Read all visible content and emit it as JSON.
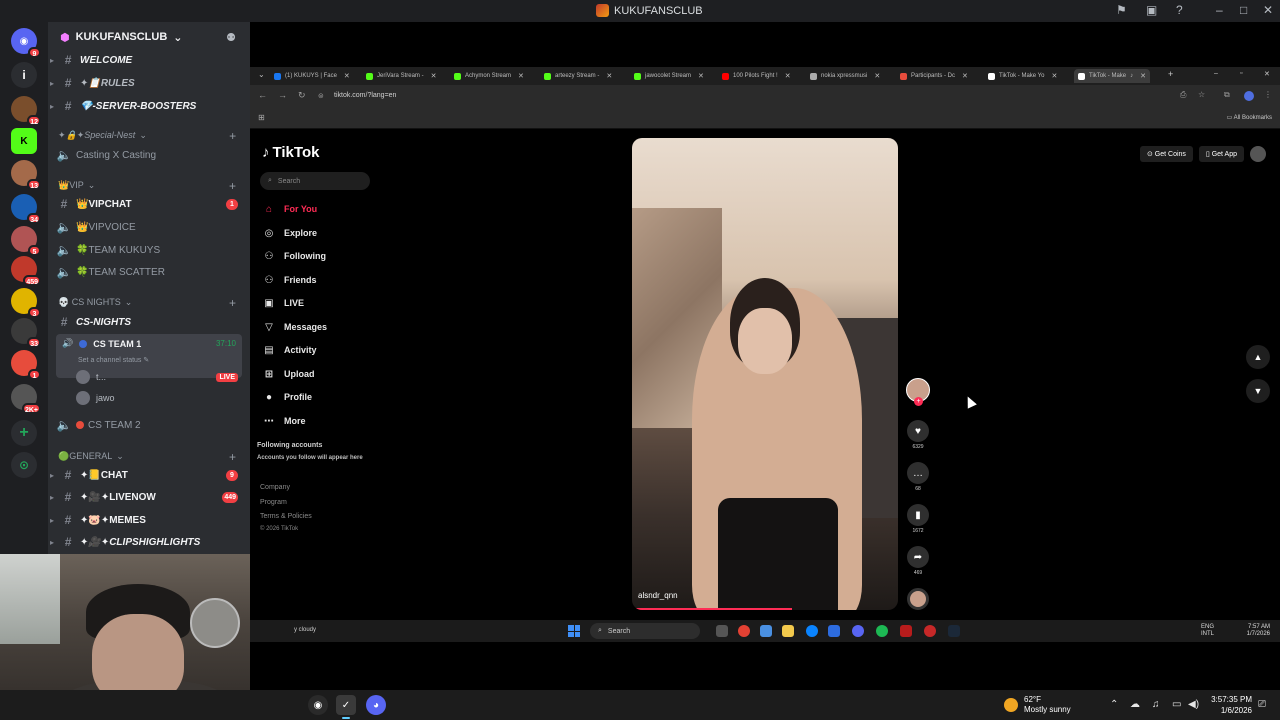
{
  "discord": {
    "title": "KUKUFANSCLUB",
    "server_name": "KUKUFANSCLUB",
    "server_badges": [
      "9",
      "12",
      "13",
      "34",
      "5",
      "459",
      "3",
      "33",
      "1",
      "2K+"
    ],
    "channels": [
      {
        "label": "WELCOME",
        "style": "ital"
      },
      {
        "label": "✦📋RULES",
        "style": "ital"
      },
      {
        "label": "💎-SERVER-BOOSTERS",
        "style": "ital"
      }
    ],
    "cat_special": "✦🔒✦Special-Nest",
    "voice_casting": "Casting X Casting",
    "cat_vip": "👑VIP",
    "vip_channels": [
      {
        "label": "👑VIPCHAT",
        "count": "1"
      },
      {
        "label": "👑VIPVOICE"
      },
      {
        "label": "🍀TEAM KUKUYS"
      },
      {
        "label": "🍀TEAM SCATTER"
      }
    ],
    "cat_cs": "💀 CS NIGHTS",
    "cs_nights": "CS-NIGHTS",
    "cs_team1": "CS TEAM 1",
    "cs_team1_timer": "37:10",
    "cs_team1_status": "Set a channel status",
    "vc_users": [
      {
        "name": "t...",
        "live": "LIVE"
      },
      {
        "name": "jawo"
      }
    ],
    "cs_team2": "CS TEAM 2",
    "cat_general": "🟢GENERAL",
    "general_channels": [
      {
        "label": "✦📒CHAT",
        "count": "9"
      },
      {
        "label": "✦🎥✦LIVENOW",
        "count": "449"
      },
      {
        "label": "✦🐷✦MEMES"
      },
      {
        "label": "✦🎥✦CLIPSHIGHLIGHTS"
      }
    ]
  },
  "browser": {
    "tabs": [
      {
        "label": "(1) KUKUYS | Face",
        "color": "#1877f2"
      },
      {
        "label": "JeriVara Stream -",
        "color": "#53fc18"
      },
      {
        "label": "Achymon Stream",
        "color": "#53fc18"
      },
      {
        "label": "arteezy Stream -",
        "color": "#53fc18"
      },
      {
        "label": "jawocolet Stream",
        "color": "#53fc18"
      },
      {
        "label": "100 Pilots Fight !",
        "color": "#ff0000"
      },
      {
        "label": "nokia xpressmusi",
        "color": "#aaaaaa"
      },
      {
        "label": "Participants - Dc",
        "color": "#e74c3c"
      },
      {
        "label": "TikTok - Make Yo",
        "color": "#ffffff"
      },
      {
        "label": "TikTok - Make",
        "color": "#ffffff"
      }
    ],
    "url": "tiktok.com/?lang=en",
    "all_bookmarks": "All Bookmarks"
  },
  "tiktok": {
    "logo": "TikTok",
    "search_placeholder": "Search",
    "nav": [
      {
        "label": "For You",
        "icon": "home-icon",
        "glyph": "⌂"
      },
      {
        "label": "Explore",
        "icon": "compass-icon",
        "glyph": "◎"
      },
      {
        "label": "Following",
        "icon": "user-icon",
        "glyph": "⚇"
      },
      {
        "label": "Friends",
        "icon": "friends-icon",
        "glyph": "⚇"
      },
      {
        "label": "LIVE",
        "icon": "live-icon",
        "glyph": "▣"
      },
      {
        "label": "Messages",
        "icon": "paper-plane-icon",
        "glyph": "▽"
      },
      {
        "label": "Activity",
        "icon": "activity-icon",
        "glyph": "▤"
      },
      {
        "label": "Upload",
        "icon": "upload-icon",
        "glyph": "⊞"
      },
      {
        "label": "Profile",
        "icon": "profile-icon",
        "glyph": "●"
      },
      {
        "label": "More",
        "icon": "more-icon",
        "glyph": "⋯"
      }
    ],
    "following_accounts": "Following accounts",
    "following_sub": "Accounts you follow will appear here",
    "footer": [
      "Company",
      "Program",
      "Terms & Policies",
      "© 2026 TikTok"
    ],
    "get_coins": "Get Coins",
    "get_app": "Get App",
    "video_handle": "alsndr_qnn",
    "video_progress": 0.6,
    "likes": "6329",
    "comments": "68",
    "saves": "1672",
    "shares": "469"
  },
  "inner_taskbar": {
    "weather": "y cloudy",
    "search": "Search",
    "lang": "ENG",
    "lang2": "INTL",
    "time": "7:57 AM",
    "date": "1/7/2026"
  },
  "taskbar": {
    "temp": "62°F",
    "condition": "Mostly sunny",
    "time": "3:57:35 PM",
    "date": "1/6/2026"
  }
}
